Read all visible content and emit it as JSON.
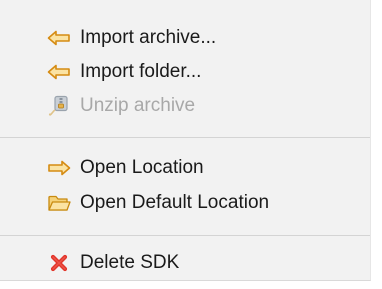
{
  "menu": {
    "items": [
      {
        "label": "Import archive...",
        "icon": "arrow-left-icon",
        "enabled": true
      },
      {
        "label": "Import folder...",
        "icon": "arrow-left-icon",
        "enabled": true
      },
      {
        "label": "Unzip archive",
        "icon": "zip-archive-icon",
        "enabled": false
      },
      {
        "label": "Open Location",
        "icon": "arrow-right-icon",
        "enabled": true
      },
      {
        "label": "Open Default Location",
        "icon": "open-folder-icon",
        "enabled": true
      },
      {
        "label": "Delete SDK",
        "icon": "delete-x-icon",
        "enabled": true
      }
    ]
  },
  "colors": {
    "arrow_fill": "#fbe3a3",
    "arrow_stroke": "#d58b12",
    "delete_red": "#e2352a",
    "disabled_text": "#a8a8a8"
  }
}
